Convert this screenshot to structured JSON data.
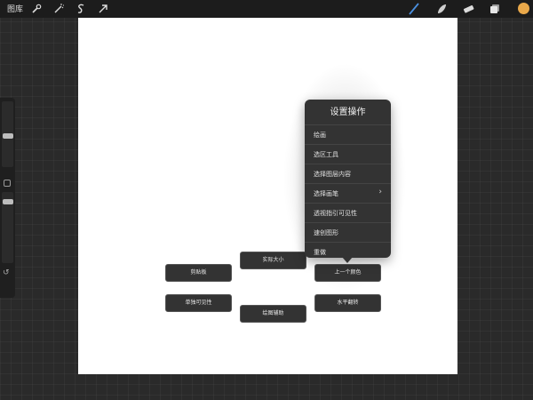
{
  "topbar": {
    "gallery_label": "图库",
    "left_icons": [
      "wrench-icon",
      "magic-wand-icon",
      "selection-s-icon",
      "transform-arrow-icon"
    ],
    "right_icons": [
      "brush-icon",
      "smudge-icon",
      "eraser-icon",
      "layers-icon"
    ],
    "color_swatch": "#e9a84a"
  },
  "menu": {
    "title": "设置操作",
    "items": [
      {
        "label": "绘画"
      },
      {
        "label": "选区工具"
      },
      {
        "label": "选择图层内容"
      },
      {
        "label": "选择画笔",
        "has_submenu": true,
        "chevron": "›"
      },
      {
        "label": "透视指引可见性"
      },
      {
        "label": "速创图形"
      },
      {
        "label": "重做"
      }
    ]
  },
  "gesture_buttons": {
    "actual_size": "实际大小",
    "clipping": "剪贴板",
    "prev_color": "上一个颜色",
    "solo_visibility": "单独可见性",
    "drawing_assist": "绘图辅助",
    "flip_horizontal": "水平翻转"
  },
  "sidebar": {
    "undo_glyph": "↺"
  }
}
